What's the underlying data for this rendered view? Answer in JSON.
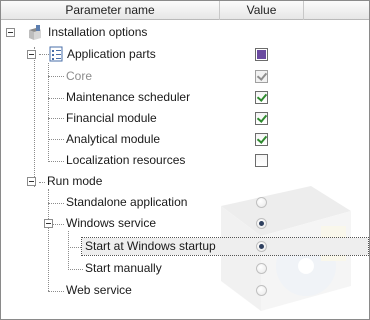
{
  "header": {
    "col_name": "Parameter name",
    "col_value": "Value"
  },
  "tree": {
    "installation_options": {
      "label": "Installation options",
      "icon": "installer-box-icon"
    },
    "application_parts": {
      "label": "Application parts",
      "icon": "checklist-icon",
      "value": "filled"
    },
    "core": {
      "label": "Core",
      "value": "checked",
      "disabled": true
    },
    "maintenance_scheduler": {
      "label": "Maintenance scheduler",
      "value": "checked"
    },
    "financial_module": {
      "label": "Financial module",
      "value": "checked"
    },
    "analytical_module": {
      "label": "Analytical module",
      "value": "checked"
    },
    "localization_resources": {
      "label": "Localization resources",
      "value": "unchecked"
    },
    "run_mode": {
      "label": "Run mode"
    },
    "standalone_application": {
      "label": "Standalone application",
      "value": "off"
    },
    "windows_service": {
      "label": "Windows service",
      "value": "on"
    },
    "start_at_windows_startup": {
      "label": "Start at Windows startup",
      "value": "on",
      "selected": true
    },
    "start_manually": {
      "label": "Start manually",
      "value": "off"
    },
    "web_service": {
      "label": "Web service",
      "value": "off"
    }
  },
  "colors": {
    "check": "#2f8a2f",
    "filled": "#6a4aa0",
    "radio": "#2e3f5e"
  }
}
